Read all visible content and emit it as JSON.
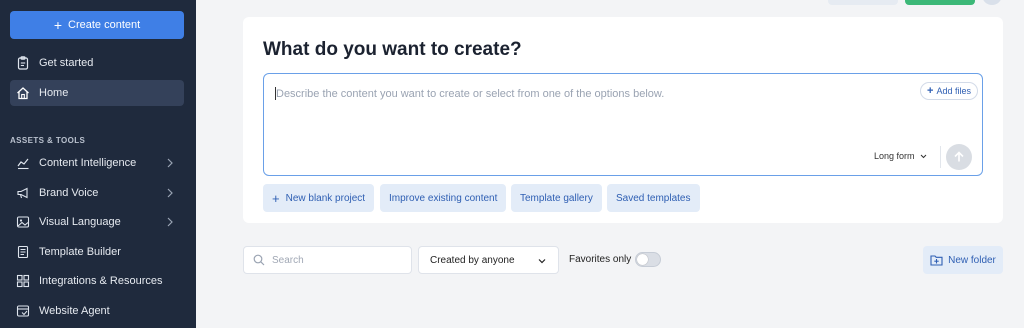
{
  "sidebar": {
    "create_button": "Create content",
    "section_label": "ASSETS & TOOLS",
    "items": [
      {
        "label": "Get started",
        "icon": "clipboard-icon"
      },
      {
        "label": "Home",
        "icon": "home-icon",
        "active": true
      },
      {
        "label": "Content Intelligence",
        "icon": "chart-icon",
        "chevron": true
      },
      {
        "label": "Brand Voice",
        "icon": "megaphone-icon",
        "chevron": true
      },
      {
        "label": "Visual Language",
        "icon": "image-icon",
        "chevron": true
      },
      {
        "label": "Template Builder",
        "icon": "document-icon"
      },
      {
        "label": "Integrations & Resources",
        "icon": "grid-icon"
      },
      {
        "label": "Website Agent",
        "icon": "browser-icon"
      }
    ]
  },
  "main": {
    "card_title": "What do you want to create?",
    "prompt": {
      "placeholder": "Describe the content you want to create or select from one of the options below.",
      "add_files": "Add files",
      "length_option": "Long form"
    },
    "chips": [
      {
        "label": "New blank project",
        "icon": "plus-icon"
      },
      {
        "label": "Improve existing content"
      },
      {
        "label": "Template gallery"
      },
      {
        "label": "Saved templates"
      }
    ],
    "filters": {
      "search_placeholder": "Search",
      "created_by": "Created by anyone",
      "favorites_label": "Favorites only",
      "favorites_on": false,
      "new_folder": "New folder"
    }
  },
  "colors": {
    "sidebar_bg": "#1f2a3d",
    "accent": "#3f7fe6",
    "chip_bg": "#e3ecf8",
    "chip_text": "#2f5fb3",
    "green": "#3cb878"
  }
}
